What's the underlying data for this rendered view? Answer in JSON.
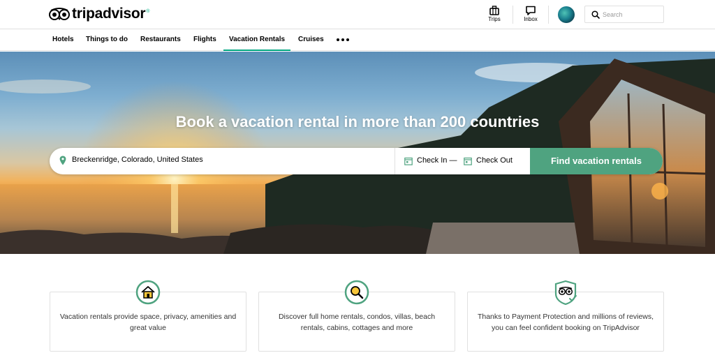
{
  "brand": {
    "name": "tripadvisor",
    "reg": "®",
    "accent": "#00af87"
  },
  "header": {
    "trips_label": "Trips",
    "inbox_label": "Inbox",
    "search_placeholder": "Search"
  },
  "nav": {
    "items": [
      {
        "label": "Hotels"
      },
      {
        "label": "Things to do"
      },
      {
        "label": "Restaurants"
      },
      {
        "label": "Flights"
      },
      {
        "label": "Vacation Rentals",
        "active": true
      },
      {
        "label": "Cruises"
      }
    ],
    "more_icon": "more-dots-icon"
  },
  "hero": {
    "title": "Book a vacation rental in more than 200 countries",
    "location_value": "Breckenridge, Colorado, United States",
    "check_in_label": "Check In —",
    "check_out_label": "Check Out",
    "find_button_label": "Find vacation rentals",
    "button_color": "#4fa380"
  },
  "features": [
    {
      "icon": "house-icon",
      "text": "Vacation rentals provide space, privacy, amenities and great value"
    },
    {
      "icon": "magnifier-icon",
      "text": "Discover full home rentals, condos, villas, beach rentals, cabins, cottages and more"
    },
    {
      "icon": "shield-owl-icon",
      "text": "Thanks to Payment Protection and millions of reviews, you can feel confident booking on TripAdvisor"
    }
  ]
}
